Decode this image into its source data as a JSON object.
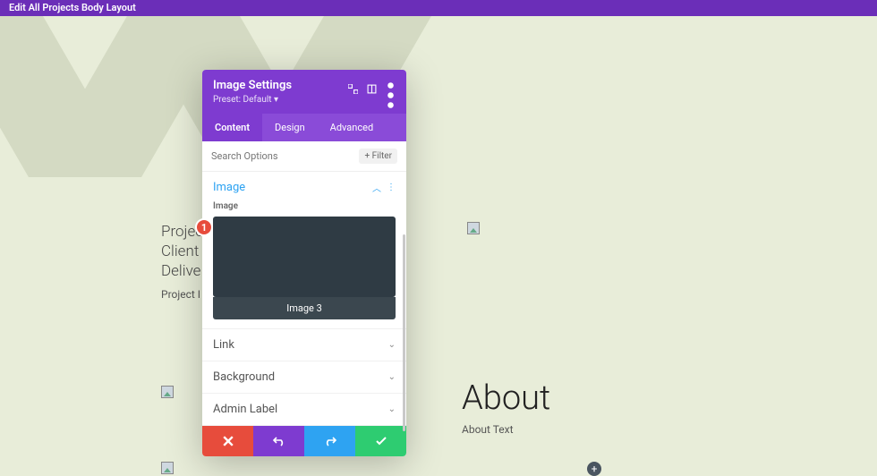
{
  "topbar": {
    "title": "Edit All Projects Body Layout"
  },
  "info": {
    "line1": "Project",
    "line2": "Client",
    "line3": "Delive",
    "desc": "Project I"
  },
  "about": {
    "heading": "About",
    "text": "About Text"
  },
  "badge": {
    "number": "1"
  },
  "modal": {
    "title": "Image Settings",
    "preset": "Preset: Default",
    "tabs": {
      "content": "Content",
      "design": "Design",
      "advanced": "Advanced"
    },
    "search": {
      "placeholder": "Search Options",
      "filter": "Filter"
    },
    "sections": {
      "image": {
        "title": "Image",
        "label": "Image",
        "caption": "Image 3"
      },
      "link": "Link",
      "background": "Background",
      "admin": "Admin Label"
    }
  }
}
